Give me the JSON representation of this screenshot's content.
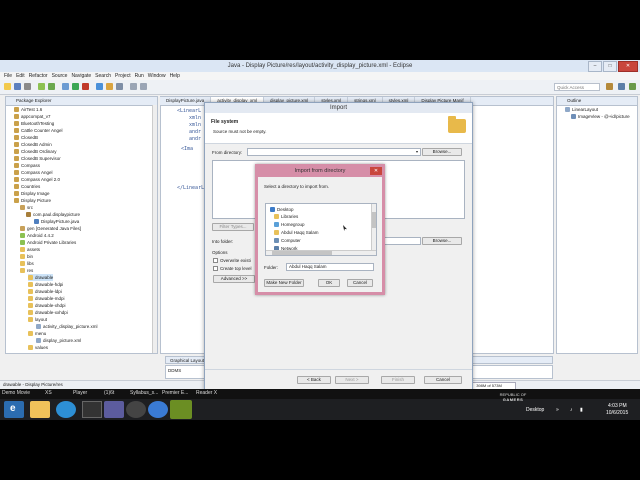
{
  "top_taskbar": {
    "items": [
      "Demo Movie",
      "XS",
      "Player",
      "(1)6t",
      "Syllabus_s...",
      "Premier E...",
      "Reader X"
    ]
  },
  "window": {
    "title": "Java - Display Picture/res/layout/activity_display_picture.xml - Eclipse",
    "menu": [
      "File",
      "Edit",
      "Refactor",
      "Source",
      "Navigate",
      "Search",
      "Project",
      "Run",
      "Window",
      "Help"
    ],
    "quick_access": "Quick Access"
  },
  "package_explorer": {
    "tab": "Package Explorer",
    "items": [
      "AirTest 1.6",
      "appcompat_v7",
      "BluetoothTesting",
      "Cattle Counter Angel",
      "ClosedB",
      "ClosedB Admin",
      "ClosedB Ordinary",
      "ClosedB Supervisor",
      "Compass",
      "Compass Angel",
      "Compass Angel 2.0",
      "Countries",
      "Display Image",
      "Display Picture",
      "src",
      "com.paul.displaypicture",
      "DisplayPicture.java",
      "gen [Generated Java Files]",
      "Android 4.4.2",
      "Android Private Libraries",
      "assets",
      "bin",
      "libs",
      "res",
      "drawable",
      "drawable-hdpi",
      "drawable-ldpi",
      "drawable-mdpi",
      "drawable-xhdpi",
      "drawable-xxhdpi",
      "layout",
      "activity_display_picture.xml",
      "menu",
      "display_picture.xml",
      "values"
    ]
  },
  "editor": {
    "tabs": [
      "DisplayPicture.java",
      "activity_display_xml",
      "display_picture.xml",
      "styles.xml",
      "strings.xml",
      "styles.xml",
      "Display Picture Manif"
    ],
    "lines": [
      "<LinearL",
      "xmln",
      "xmln",
      "andr",
      "andr",
      "<Ima",
      "</LinearL"
    ]
  },
  "outline": {
    "tab": "Outline",
    "items": [
      "LinearLayout",
      "ImageView - @+id/picture"
    ]
  },
  "bottom": {
    "tabs": "Graphical Layout",
    "ddms": "DDMS"
  },
  "status": {
    "left": "drawable - Display Picture/res",
    "memory": "398M of 573M"
  },
  "import_dialog": {
    "title": "Import",
    "heading": "File system",
    "message": "Source must not be empty.",
    "from_dir_label": "From directory:",
    "browse": "Browse...",
    "filter_types": "Filter Types...",
    "into_folder_label": "Into folder:",
    "options_label": "Options",
    "overwrite": "Overwrite existi",
    "create_top": "Create top level",
    "advanced": "Advanced >>",
    "back": "< Back",
    "next": "Next >",
    "finish": "Finish",
    "cancel": "Cancel"
  },
  "dir_dialog": {
    "title": "Import from directory",
    "prompt": "Select a directory to import from.",
    "tree": [
      "Desktop",
      "Libraries",
      "Homegroup",
      "Abdul Haqq Salam",
      "Computer",
      "Network"
    ],
    "folder_label": "Folder:",
    "folder_value": "Abdul Haqq Salam",
    "make_new_folder": "Make New Folder",
    "ok": "OK",
    "cancel": "Cancel"
  },
  "taskbar": {
    "watermark_line1": "REPUBLIC OF",
    "watermark_line2": "GAMERS",
    "desktop": "Desktop",
    "time": "4:03 PM",
    "date": "10/6/2015"
  },
  "colors": {
    "accent": "#d68ea8",
    "title_bg": "#dbe6f4",
    "taskbar": "#1e1f22"
  }
}
